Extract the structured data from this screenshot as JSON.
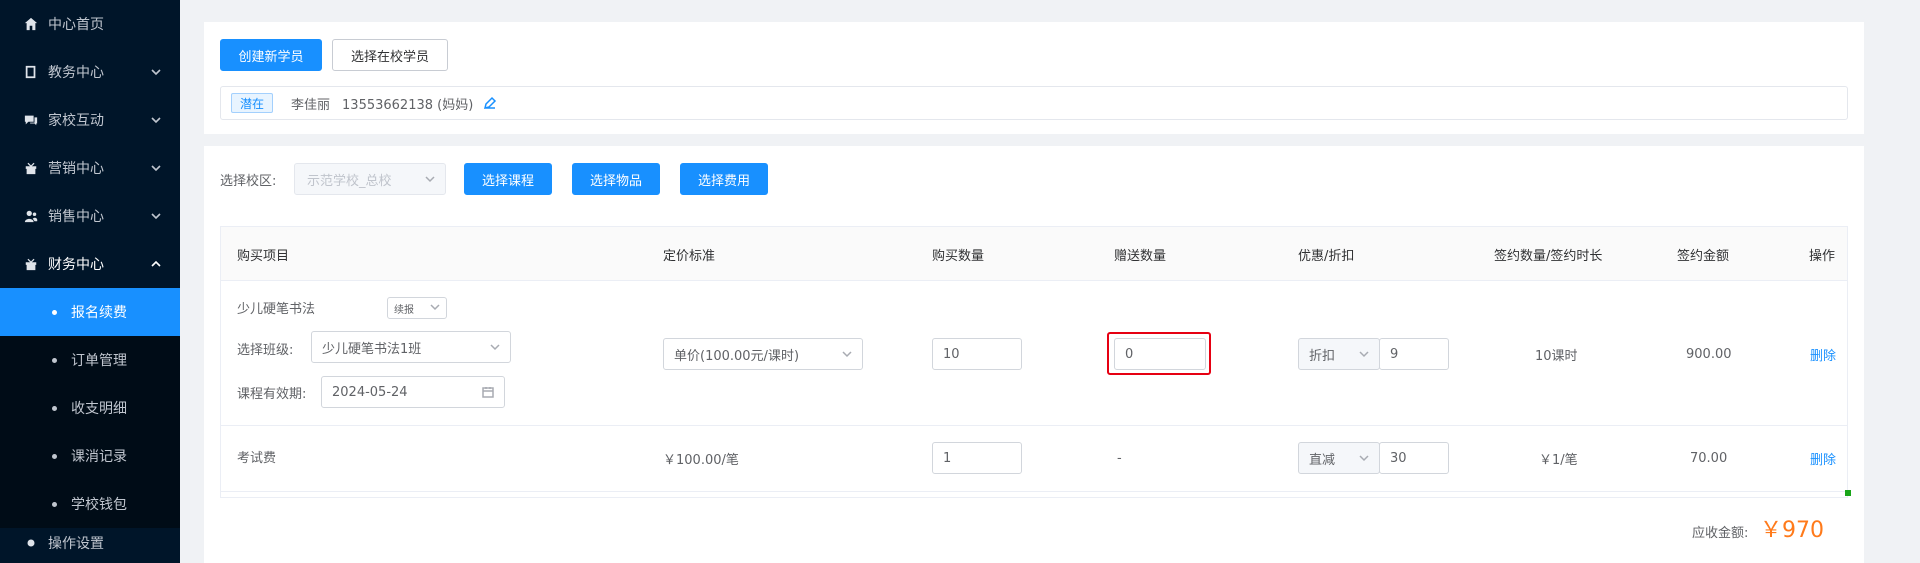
{
  "sidebar": {
    "items": [
      {
        "label": "中心首页",
        "icon": "home-icon"
      },
      {
        "label": "教务中心",
        "icon": "book-icon"
      },
      {
        "label": "家校互动",
        "icon": "chat-icon"
      },
      {
        "label": "营销中心",
        "icon": "gift-icon"
      },
      {
        "label": "销售中心",
        "icon": "user-group-icon"
      },
      {
        "label": "财务中心",
        "icon": "finance-icon"
      }
    ],
    "sub_items": [
      {
        "label": "报名续费",
        "active": true
      },
      {
        "label": "订单管理"
      },
      {
        "label": "收支明细"
      },
      {
        "label": "课消记录"
      },
      {
        "label": "学校钱包"
      }
    ],
    "cut_item": "操作设置"
  },
  "top": {
    "create_btn": "创建新学员",
    "select_btn": "选择在校学员",
    "student": {
      "tag": "潜在",
      "name": "李佳丽",
      "phone": "13553662138 (妈妈)"
    }
  },
  "order": {
    "campus_label": "选择校区:",
    "campus_value": "示范学校_总校",
    "btn_course": "选择课程",
    "btn_item": "选择物品",
    "btn_fee": "选择费用",
    "columns": [
      "购买项目",
      "定价标准",
      "购买数量",
      "赠送数量",
      "优惠/折扣",
      "签约数量/签约时长",
      "签约金额",
      "操作"
    ],
    "row1": {
      "name": "少儿硬笔书法",
      "mode": "续报",
      "class_label": "选择班级:",
      "class_value": "少儿硬笔书法1班",
      "validity_label": "课程有效期:",
      "validity_value": "2024-05-24",
      "price": "单价(100.00元/课时)",
      "qty": "10",
      "gift": "0",
      "discount_type": "折扣",
      "discount_value": "9",
      "contract": "10课时",
      "amount": "900.00",
      "action": "删除"
    },
    "row2": {
      "name": "考试费",
      "price": "￥100.00/笔",
      "qty": "1",
      "gift": "-",
      "discount_type": "直减",
      "discount_value": "30",
      "contract": "￥1/笔",
      "amount": "70.00",
      "action": "删除"
    },
    "total_label": "应收金额:",
    "total_value": "￥970"
  },
  "colors": {
    "sidebar_bg": "#001529",
    "primary": "#1890ff",
    "highlight": "#e60012",
    "total": "#ff7a1a"
  }
}
